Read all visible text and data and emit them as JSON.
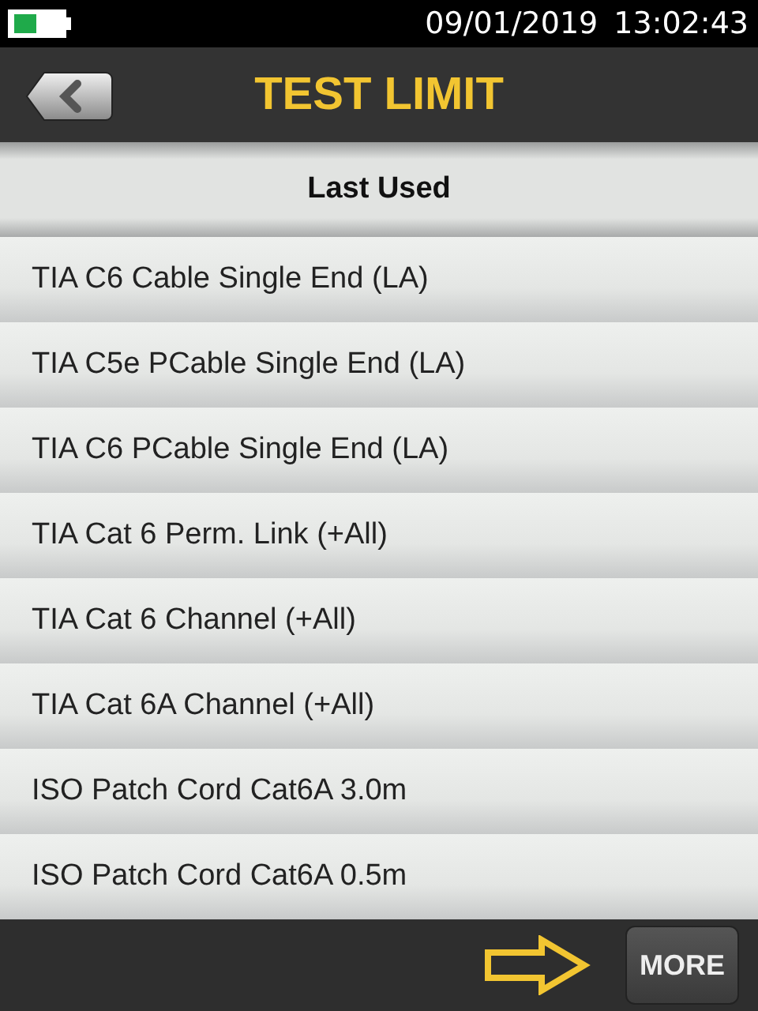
{
  "status_bar": {
    "date": "09/01/2019",
    "time": "13:02:43"
  },
  "header": {
    "title": "TEST LIMIT"
  },
  "section": {
    "title": "Last Used"
  },
  "items": [
    {
      "label": "TIA C6 Cable Single End (LA)"
    },
    {
      "label": "TIA C5e PCable Single End (LA)"
    },
    {
      "label": "TIA C6 PCable Single End (LA)"
    },
    {
      "label": "TIA Cat 6 Perm. Link (+All)"
    },
    {
      "label": "TIA Cat 6 Channel (+All)"
    },
    {
      "label": "TIA Cat 6A Channel (+All)"
    },
    {
      "label": "ISO Patch Cord Cat6A 3.0m"
    },
    {
      "label": "ISO Patch Cord Cat6A 0.5m"
    }
  ],
  "footer": {
    "more_button": "MORE"
  }
}
